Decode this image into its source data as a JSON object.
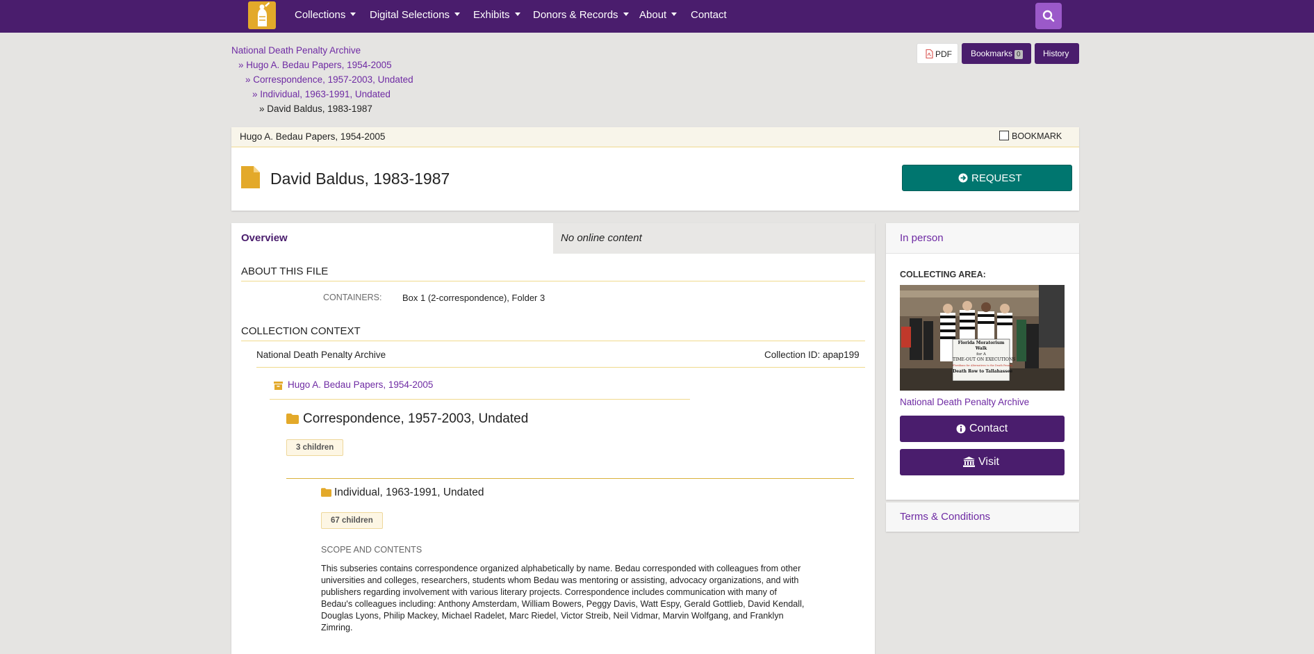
{
  "colors": {
    "brand_purple": "#4a1d6d",
    "link_purple": "#6e2aa3",
    "request_teal": "#00766f",
    "gold": "#e3a92a"
  },
  "nav": {
    "logo_icon": "torch-statue-logo",
    "items": [
      {
        "label": "Collections",
        "dropdown": true
      },
      {
        "label": "Digital Selections",
        "dropdown": true
      },
      {
        "label": "Exhibits",
        "dropdown": true
      },
      {
        "label": "Donors & Records",
        "dropdown": true
      },
      {
        "label": "About",
        "dropdown": true
      },
      {
        "label": "Contact",
        "dropdown": false
      }
    ],
    "search_icon": "search-icon"
  },
  "breadcrumb": [
    "National Death Penalty Archive",
    "» Hugo A. Bedau Papers, 1954-2005",
    "» Correspondence, 1957-2003, Undated",
    "» Individual, 1963-1991, Undated",
    "» David Baldus, 1983-1987"
  ],
  "toolbar": {
    "pdf_label": "PDF",
    "bookmarks_label": "Bookmarks",
    "bookmarks_count": "0",
    "history_label": "History"
  },
  "record": {
    "collection_title": "Hugo A. Bedau Papers, 1954-2005",
    "bookmark_label": "BOOKMARK",
    "title": "David Baldus, 1983-1987",
    "request_label": "REQUEST"
  },
  "tabs": {
    "overview": "Overview",
    "online": "No online content"
  },
  "about": {
    "heading": "ABOUT THIS FILE",
    "containers_label": "CONTAINERS:",
    "containers_value": "Box 1 (2-correspondence), Folder 3"
  },
  "context": {
    "heading": "COLLECTION CONTEXT",
    "repository": "National Death Penalty Archive",
    "collection_id": "Collection ID: apap199",
    "collection_link": "Hugo A. Bedau Papers, 1954-2005",
    "series_title": "Correspondence, 1957-2003, Undated",
    "series_children": "3 children",
    "subseries_title": "Individual, 1963-1991, Undated",
    "subseries_children": "67 children",
    "scope_heading": "SCOPE AND CONTENTS",
    "scope_lines": [
      "This subseries contains correspondence organized alphabetically by name. Bedau corresponded with colleagues from other",
      "universities and colleges, researchers, students whom Bedau was mentoring or assisting, advocacy organizations, and with",
      "publishers regarding involvement with various literary projects. Correspondence includes communication with many of",
      "Bedau's colleagues including: Anthony Amsterdam, William Bowers, Peggy Davis, Watt Espy, Gerald Gottlieb, David Kendall,",
      "Douglas Lyons, Philip Mackey, Michael Radelet, Marc Riedel, Victor Streib, Neil Vidmar, Marvin Wolfgang, and Franklyn",
      "Zimring."
    ]
  },
  "sidebar": {
    "in_person": "In person",
    "collecting_area_label": "COLLECTING AREA:",
    "photo_sign_lines": [
      "Florida Moratorium Walk",
      "for A",
      "TIME-OUT ON EXECUTIONS",
      "Floridians for Alternatives to the Death Penalty",
      "Death Row to Tallahassee"
    ],
    "area_link": "National Death Penalty Archive",
    "contact_label": "Contact",
    "visit_label": "Visit",
    "terms_label": "Terms & Conditions"
  }
}
